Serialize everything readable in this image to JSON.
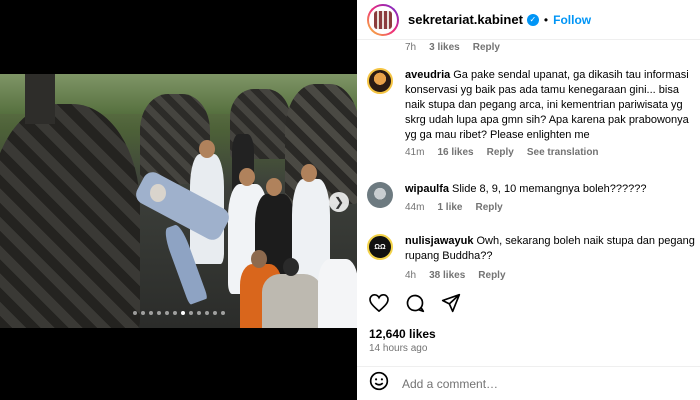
{
  "post": {
    "username": "sekretariat.kabinet",
    "separator": "•",
    "follow_label": "Follow",
    "likes": "12,640 likes",
    "posted": "14 hours ago",
    "add_comment_placeholder": "Add a comment…",
    "carousel_dots": 12,
    "carousel_active_index": 6
  },
  "comments": [
    {
      "username": "",
      "text": "",
      "time": "7h",
      "likes": "3 likes",
      "reply": "Reply",
      "extra": ""
    },
    {
      "username": "aveudria",
      "text": "Ga pake sendal upanat, ga dikasih tau informasi konservasi yg baik pas ada tamu kenegaraan gini... bisa naik stupa dan pegang arca, ini kementrian pariwisata yg skrg udah lupa apa gmn sih? Apa karena pak prabowonya yg ga mau ribet? Please enlighten me",
      "time": "41m",
      "likes": "16 likes",
      "reply": "Reply",
      "extra": "See translation"
    },
    {
      "username": "wipaulfa",
      "text": "Slide 8, 9, 10 memangnya boleh??????",
      "time": "44m",
      "likes": "1 like",
      "reply": "Reply",
      "extra": ""
    },
    {
      "username": "nulisjawayuk",
      "text": "Owh, sekarang boleh naik stupa dan pegang rupang Buddha??",
      "time": "4h",
      "likes": "38 likes",
      "reply": "Reply",
      "extra": ""
    }
  ],
  "icons": {
    "verified": "verified-badge-icon",
    "like": "heart-icon",
    "comment": "comment-bubble-icon",
    "share": "paper-plane-icon",
    "emoji": "smiley-icon",
    "next": "chevron-right-icon"
  },
  "colors": {
    "accent": "#0095f6",
    "meta_text": "#737373"
  }
}
